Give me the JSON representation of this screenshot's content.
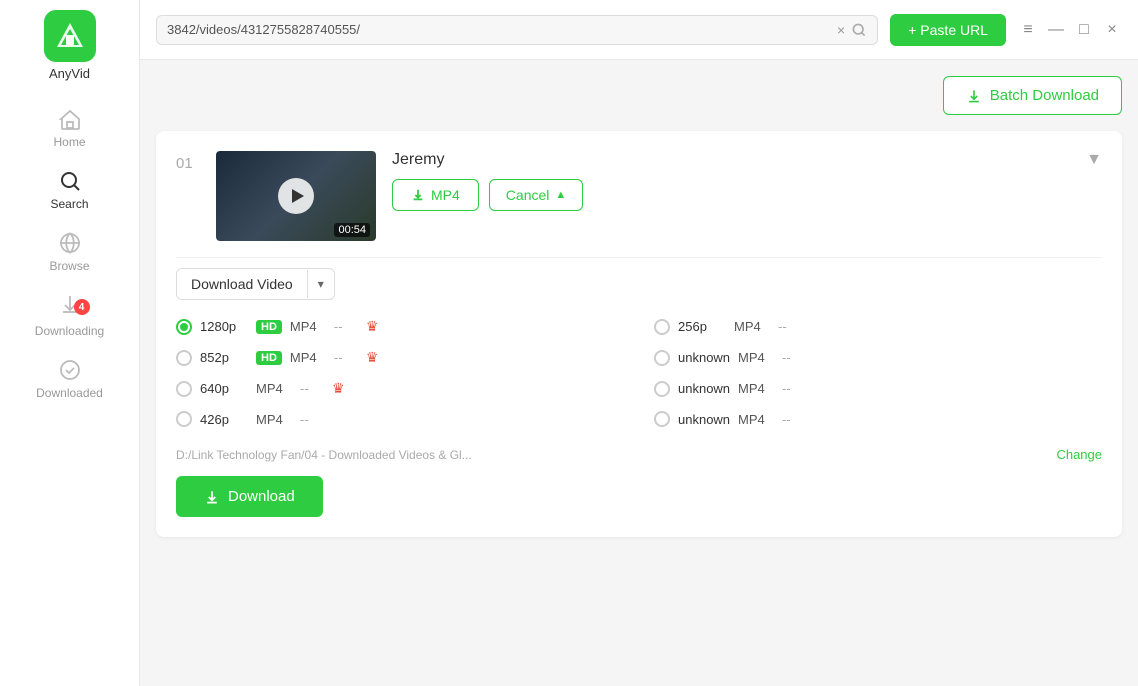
{
  "app": {
    "name": "AnyVid",
    "logo_color": "#2ecc40"
  },
  "sidebar": {
    "items": [
      {
        "id": "home",
        "label": "Home",
        "active": false
      },
      {
        "id": "search",
        "label": "Search",
        "active": true
      },
      {
        "id": "browse",
        "label": "Browse",
        "active": false
      },
      {
        "id": "downloading",
        "label": "Downloading",
        "active": false,
        "badge": "4"
      },
      {
        "id": "downloaded",
        "label": "Downloaded",
        "active": false
      }
    ]
  },
  "topbar": {
    "url": "3842/videos/4312755828740555/",
    "clear_label": "×",
    "paste_url_label": "+ Paste URL",
    "window_controls": [
      "≡",
      "—",
      "□",
      "×"
    ]
  },
  "batch_download": {
    "label": "Batch Download"
  },
  "video": {
    "index": "01",
    "title": "Jeremy",
    "duration": "00:54",
    "mp4_label": "MP4",
    "cancel_label": "Cancel",
    "download_type": "Download Video",
    "qualities": [
      {
        "res": "1280p",
        "hd": true,
        "format": "MP4",
        "dash": "--",
        "crown": true,
        "selected": true,
        "side": "left"
      },
      {
        "res": "256p",
        "hd": false,
        "format": "MP4",
        "dash": "--",
        "crown": false,
        "selected": false,
        "side": "right"
      },
      {
        "res": "852p",
        "hd": true,
        "format": "MP4",
        "dash": "--",
        "crown": true,
        "selected": false,
        "side": "left"
      },
      {
        "res": "unknown",
        "hd": false,
        "format": "MP4",
        "dash": "--",
        "crown": false,
        "selected": false,
        "side": "right"
      },
      {
        "res": "640p",
        "hd": false,
        "format": "MP4",
        "dash": "--",
        "crown": true,
        "selected": false,
        "side": "left"
      },
      {
        "res": "unknown",
        "hd": false,
        "format": "MP4",
        "dash": "--",
        "crown": false,
        "selected": false,
        "side": "right"
      },
      {
        "res": "426p",
        "hd": false,
        "format": "MP4",
        "dash": "--",
        "crown": false,
        "selected": false,
        "side": "left"
      },
      {
        "res": "unknown",
        "hd": false,
        "format": "MP4",
        "dash": "--",
        "crown": false,
        "selected": false,
        "side": "right"
      }
    ],
    "download_path": "D:/Link Technology Fan/04 - Downloaded Videos & Gl...",
    "change_label": "Change",
    "download_label": "Download"
  }
}
